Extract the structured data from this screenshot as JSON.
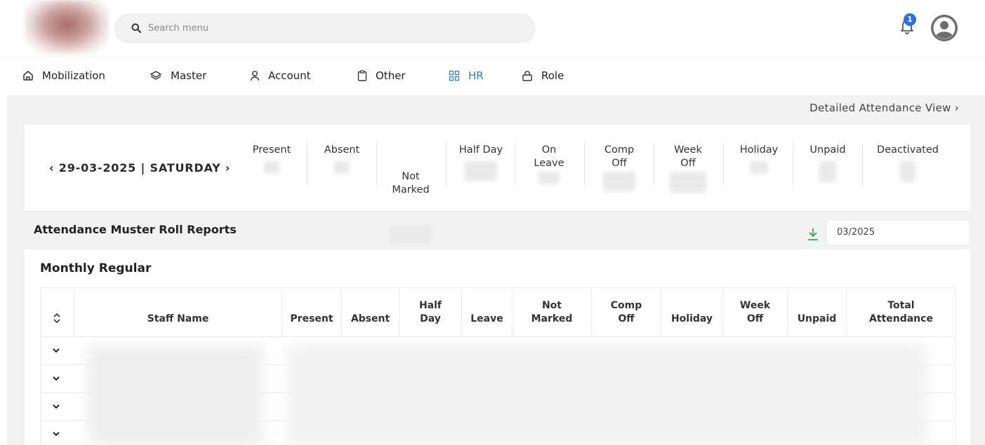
{
  "header": {
    "search_placeholder": "Search menu",
    "notification_count": "1",
    "icons": [
      "search-icon",
      "bell-icon",
      "user-avatar-icon"
    ]
  },
  "nav": {
    "items": [
      {
        "label": "Mobilization",
        "icon": "home-icon"
      },
      {
        "label": "Master",
        "icon": "layers-icon"
      },
      {
        "label": "Account",
        "icon": "user-icon"
      },
      {
        "label": "Other",
        "icon": "clipboard-icon"
      },
      {
        "label": "HR",
        "icon": "grid-icon",
        "active": true
      },
      {
        "label": "Role",
        "icon": "lock-icon"
      }
    ],
    "active_color": "#2c7be5"
  },
  "attendance": {
    "detail_link": "Detailed Attendance View ›",
    "date_label": "‹ 29-03-2025 | SATURDAY ›",
    "stats": [
      {
        "label": "Present"
      },
      {
        "label": "Absent"
      },
      {
        "label": "Not\nMarked"
      },
      {
        "label": "Half Day"
      },
      {
        "label": "On\nLeave"
      },
      {
        "label": "Comp\nOff"
      },
      {
        "label": "Week\nOff"
      },
      {
        "label": "Holiday"
      },
      {
        "label": "Unpaid"
      },
      {
        "label": "Deactivated"
      }
    ]
  },
  "reports": {
    "title": "Attendance Muster Roll Reports",
    "month_value": "03/2025",
    "download_color": "#2e9e57",
    "table_title": "Monthly Regular",
    "columns": [
      {
        "label": "Staff Name"
      },
      {
        "label": "Present"
      },
      {
        "label": "Absent"
      },
      {
        "label": "Half\nDay"
      },
      {
        "label": "Leave"
      },
      {
        "label": "Not\nMarked"
      },
      {
        "label": "Comp\nOff"
      },
      {
        "label": "Holiday"
      },
      {
        "label": "Week\nOff"
      },
      {
        "label": "Unpaid"
      },
      {
        "label": "Total\nAttendance"
      }
    ]
  }
}
